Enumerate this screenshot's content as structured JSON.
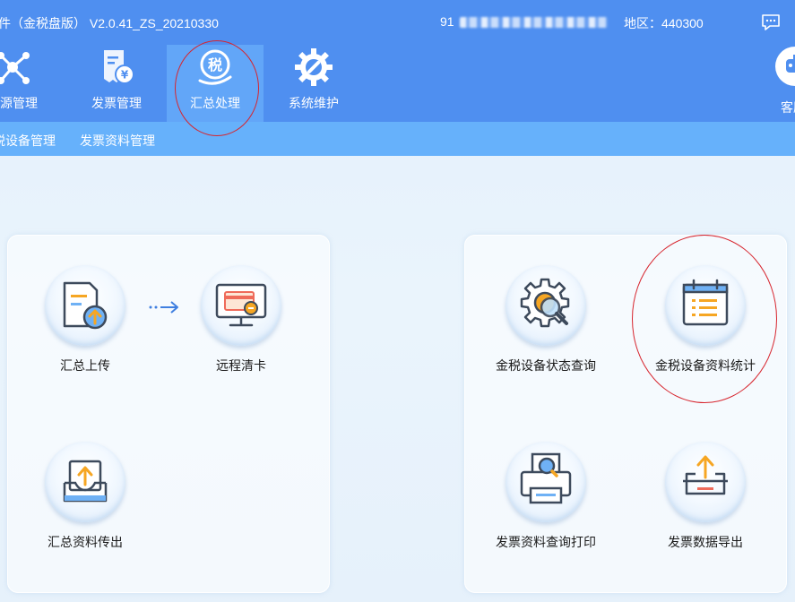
{
  "titlebar": {
    "app_title": "件（金税盘版） V2.0.41_ZS_20210330",
    "tax_id_prefix": "91",
    "region": "地区：440300",
    "message_icon": "chat-bubble-icon"
  },
  "nav": {
    "tabs": [
      {
        "label": "票源管理",
        "icon": "network-nodes-icon"
      },
      {
        "label": "发票管理",
        "icon": "invoice-yen-icon"
      },
      {
        "label": "汇总处理",
        "icon": "tax-summary-icon",
        "active": true
      },
      {
        "label": "系统维护",
        "icon": "wrench-gear-icon"
      }
    ],
    "service_label": "客服",
    "service_icon": "robot-icon"
  },
  "subnav": {
    "items": [
      "税设备管理",
      "发票资料管理"
    ]
  },
  "left_panel": {
    "items": [
      {
        "label": "汇总上传",
        "icon": "upload-document-icon"
      },
      {
        "label": "远程清卡",
        "icon": "monitor-card-icon"
      },
      {
        "label": "汇总资料传出",
        "icon": "tray-upload-icon"
      }
    ],
    "arrow_icon": "dotted-arrow-right-icon"
  },
  "right_panel": {
    "items": [
      {
        "label": "金税设备状态查询",
        "icon": "gear-search-icon"
      },
      {
        "label": "金税设备资料统计",
        "icon": "calendar-list-icon"
      },
      {
        "label": "发票资料查询打印",
        "icon": "printer-search-icon"
      },
      {
        "label": "发票数据导出",
        "icon": "export-tray-icon"
      }
    ]
  },
  "colors": {
    "titlebar": "#4f8ff0",
    "active_tab": "#62a6f8",
    "subnav": "#66b1fb",
    "highlight_ellipse": "#d7252e"
  }
}
